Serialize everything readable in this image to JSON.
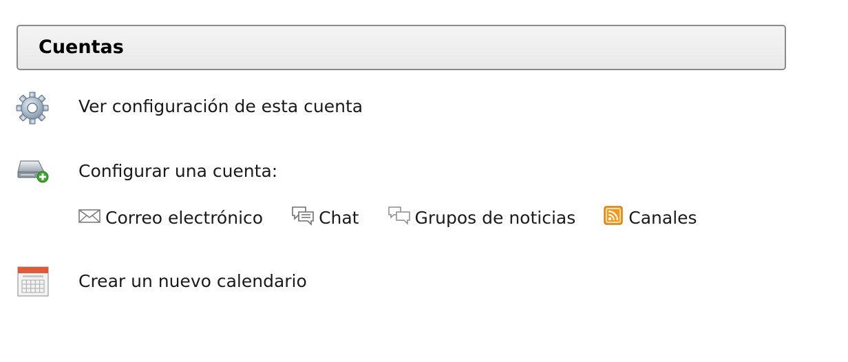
{
  "header": {
    "title": "Cuentas"
  },
  "actions": {
    "view_settings": {
      "label": "Ver configuración de esta cuenta",
      "icon": "gear-icon"
    },
    "setup_account": {
      "label": "Configurar una cuenta:",
      "icon": "add-account-icon"
    },
    "new_calendar": {
      "label": "Crear un nuevo calendario",
      "icon": "calendar-icon"
    }
  },
  "account_types": [
    {
      "label": "Correo electrónico",
      "icon": "envelope-icon"
    },
    {
      "label": "Chat",
      "icon": "chat-icon"
    },
    {
      "label": "Grupos de noticias",
      "icon": "newsgroup-icon"
    },
    {
      "label": "Canales",
      "icon": "rss-icon"
    }
  ],
  "colors": {
    "rss_orange": "#f39a1e",
    "calendar_red": "#e2593a",
    "add_green": "#3aa62b"
  }
}
